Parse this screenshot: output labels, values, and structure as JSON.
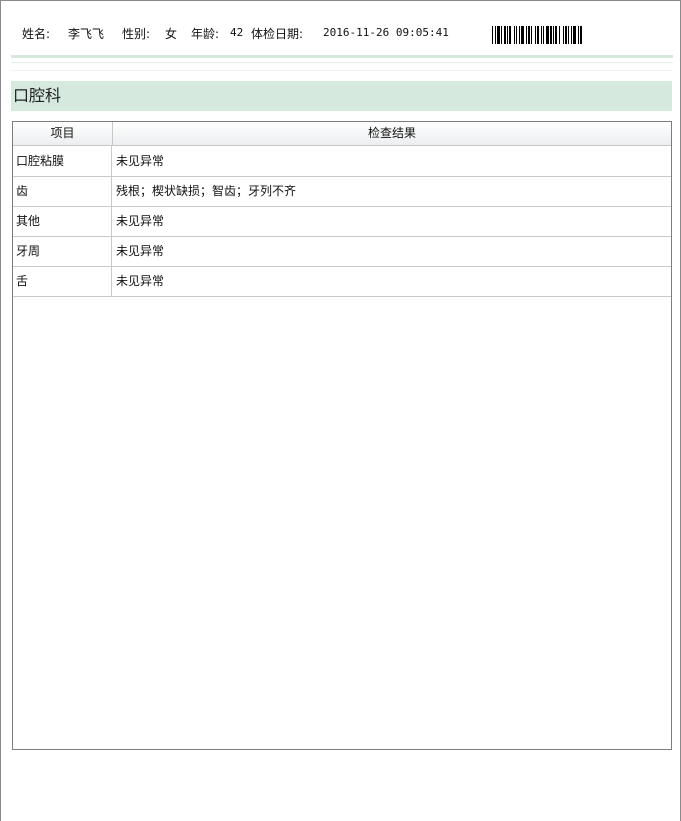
{
  "patient": {
    "name_label": "姓名:",
    "name": "李飞飞",
    "sex_label": "性别:",
    "sex": "女",
    "age_label": "年龄:",
    "age": "42",
    "date_label": "体检日期:",
    "date": "2016-11-26 09:05:41"
  },
  "section": {
    "title": "口腔科"
  },
  "table": {
    "headers": [
      "项目",
      "检查结果"
    ],
    "rows": [
      {
        "item": "口腔粘膜",
        "result": "未见异常"
      },
      {
        "item": "齿",
        "result": "残根；楔状缺损；智齿；牙列不齐"
      },
      {
        "item": "其他",
        "result": "未见异常"
      },
      {
        "item": "牙周",
        "result": "未见异常"
      },
      {
        "item": "舌",
        "result": "未见异常"
      }
    ]
  }
}
